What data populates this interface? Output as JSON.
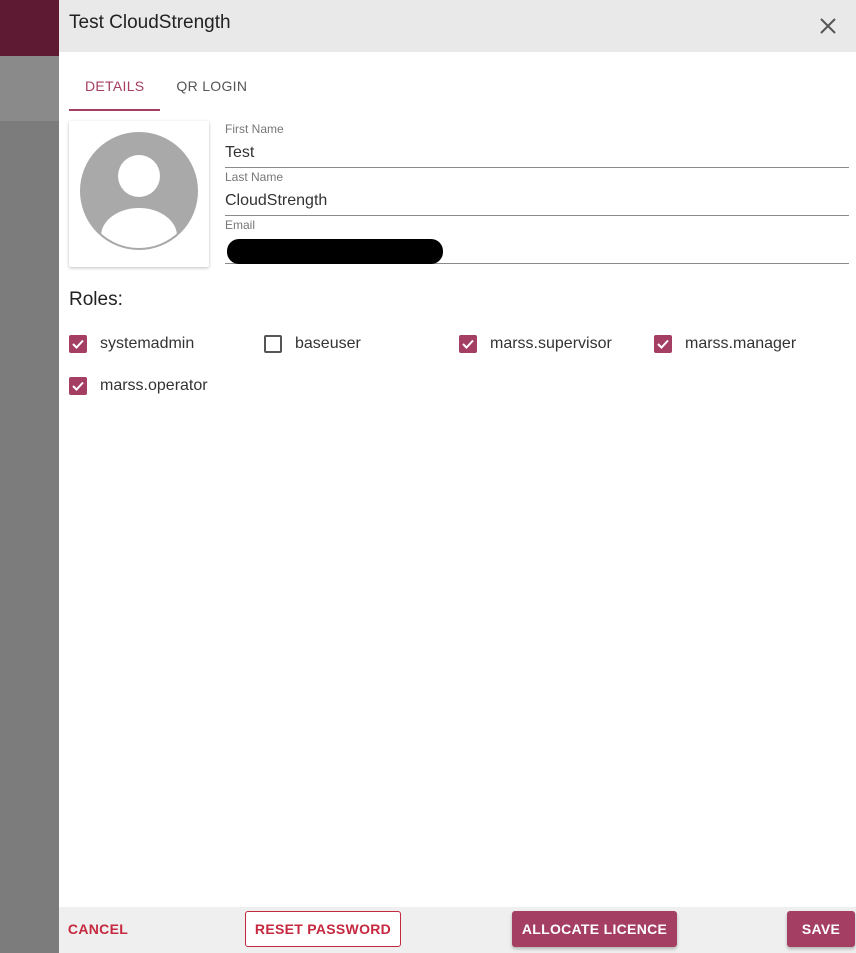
{
  "drawer": {
    "title": "Test CloudStrength",
    "close_icon": "close-icon"
  },
  "tabs": [
    {
      "label": "DETAILS",
      "active": true
    },
    {
      "label": "QR LOGIN",
      "active": false
    }
  ],
  "avatar": {
    "icon": "user-avatar-icon"
  },
  "form": {
    "first_name": {
      "label": "First Name",
      "value": "Test"
    },
    "last_name": {
      "label": "Last Name",
      "value": "CloudStrength"
    },
    "email": {
      "label": "Email",
      "value": ""
    }
  },
  "roles": {
    "title": "Roles:",
    "items": [
      {
        "label": "systemadmin",
        "checked": true
      },
      {
        "label": "baseuser",
        "checked": false
      },
      {
        "label": "marss.supervisor",
        "checked": true
      },
      {
        "label": "marss.manager",
        "checked": true
      },
      {
        "label": "marss.operator",
        "checked": true
      }
    ]
  },
  "footer": {
    "cancel_label": "CANCEL",
    "reset_label": "RESET PASSWORD",
    "allocate_label": "ALLOCATE LICENCE",
    "save_label": "SAVE"
  },
  "colors": {
    "accent": "#a43e62",
    "danger": "#c5283f",
    "topbar": "#5e1a32"
  }
}
